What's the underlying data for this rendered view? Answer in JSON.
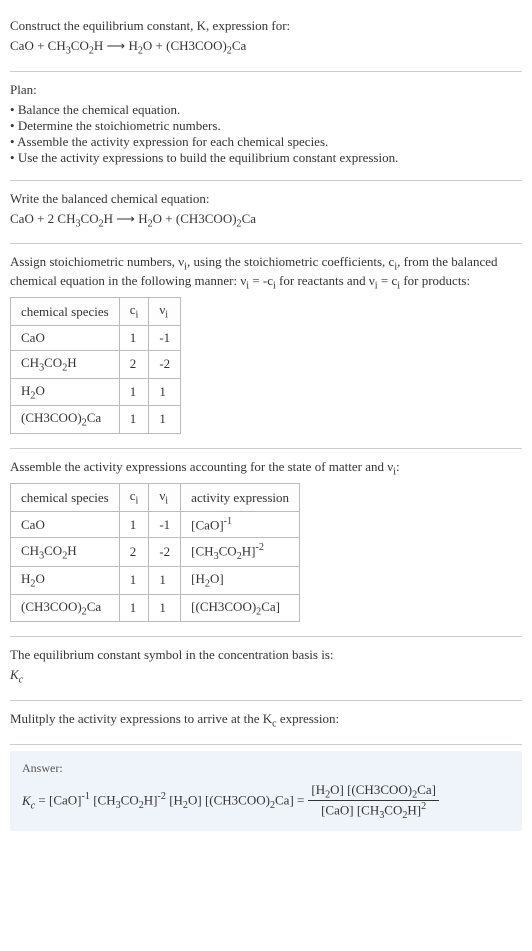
{
  "intro": {
    "line1": "Construct the equilibrium constant, K, expression for:",
    "eq_lhs1": "CaO + CH",
    "eq_lhs2": "3",
    "eq_lhs3": "CO",
    "eq_lhs4": "2",
    "eq_lhs5": "H  ⟶  H",
    "eq_lhs6": "2",
    "eq_lhs7": "O + (CH3COO)",
    "eq_lhs8": "2",
    "eq_lhs9": "Ca"
  },
  "plan": {
    "heading": "Plan:",
    "b1": "Balance the chemical equation.",
    "b2": "Determine the stoichiometric numbers.",
    "b3": "Assemble the activity expression for each chemical species.",
    "b4": "Use the activity expressions to build the equilibrium constant expression."
  },
  "balanced": {
    "heading": "Write the balanced chemical equation:",
    "p1": "CaO + 2 CH",
    "p2": "3",
    "p3": "CO",
    "p4": "2",
    "p5": "H  ⟶  H",
    "p6": "2",
    "p7": "O + (CH3COO)",
    "p8": "2",
    "p9": "Ca"
  },
  "stoich": {
    "intro1": "Assign stoichiometric numbers, ν",
    "intro1_i": "i",
    "intro2": ", using the stoichiometric coefficients, c",
    "intro2_i": "i",
    "intro3": ", from the balanced chemical equation in the following manner: ν",
    "intro3_i": "i",
    "intro4": " = -c",
    "intro4_i": "i",
    "intro5": " for reactants and ν",
    "intro5_i": "i",
    "intro6": " = c",
    "intro6_i": "i",
    "intro7": " for products:",
    "table": {
      "h1": "chemical species",
      "h2": "c",
      "h2_i": "i",
      "h3": "ν",
      "h3_i": "i",
      "r1c1": "CaO",
      "r1c2": "1",
      "r1c3": "-1",
      "r2c1a": "CH",
      "r2c1b": "3",
      "r2c1c": "CO",
      "r2c1d": "2",
      "r2c1e": "H",
      "r2c2": "2",
      "r2c3": "-2",
      "r3c1a": "H",
      "r3c1b": "2",
      "r3c1c": "O",
      "r3c2": "1",
      "r3c3": "1",
      "r4c1a": "(CH3COO)",
      "r4c1b": "2",
      "r4c1c": "Ca",
      "r4c2": "1",
      "r4c3": "1"
    }
  },
  "activity": {
    "heading1": "Assemble the activity expressions accounting for the state of matter and ν",
    "heading1_i": "i",
    "heading2": ":",
    "table": {
      "h1": "chemical species",
      "h2": "c",
      "h2_i": "i",
      "h3": "ν",
      "h3_i": "i",
      "h4": "activity expression",
      "r1c1": "CaO",
      "r1c2": "1",
      "r1c3": "-1",
      "r1c4a": "[CaO]",
      "r1c4b": "-1",
      "r2c1a": "CH",
      "r2c1b": "3",
      "r2c1c": "CO",
      "r2c1d": "2",
      "r2c1e": "H",
      "r2c2": "2",
      "r2c3": "-2",
      "r2c4a": "[CH",
      "r2c4b": "3",
      "r2c4c": "CO",
      "r2c4d": "2",
      "r2c4e": "H]",
      "r2c4f": "-2",
      "r3c1a": "H",
      "r3c1b": "2",
      "r3c1c": "O",
      "r3c2": "1",
      "r3c3": "1",
      "r3c4a": "[H",
      "r3c4b": "2",
      "r3c4c": "O]",
      "r4c1a": "(CH3COO)",
      "r4c1b": "2",
      "r4c1c": "Ca",
      "r4c2": "1",
      "r4c3": "1",
      "r4c4a": "[(CH3COO)",
      "r4c4b": "2",
      "r4c4c": "Ca]"
    }
  },
  "symbol": {
    "heading": "The equilibrium constant symbol in the concentration basis is:",
    "k": "K",
    "kc": "c"
  },
  "multiply": {
    "heading1": "Mulitply the activity expressions to arrive at the K",
    "heading1_c": "c",
    "heading2": " expression:"
  },
  "answer": {
    "label": "Answer:",
    "k": "K",
    "kc": "c",
    "eq": " = ",
    "t1": "[CaO]",
    "t1e": "-1",
    "t2a": " [CH",
    "t2b": "3",
    "t2c": "CO",
    "t2d": "2",
    "t2e": "H]",
    "t2f": "-2",
    "t3a": " [H",
    "t3b": "2",
    "t3c": "O]",
    "t4a": " [(CH3COO)",
    "t4b": "2",
    "t4c": "Ca] = ",
    "num1": "[H",
    "num2": "2",
    "num3": "O] [(CH3COO)",
    "num4": "2",
    "num5": "Ca]",
    "den1": "[CaO] [CH",
    "den2": "3",
    "den3": "CO",
    "den4": "2",
    "den5": "H]",
    "den6": "2"
  }
}
